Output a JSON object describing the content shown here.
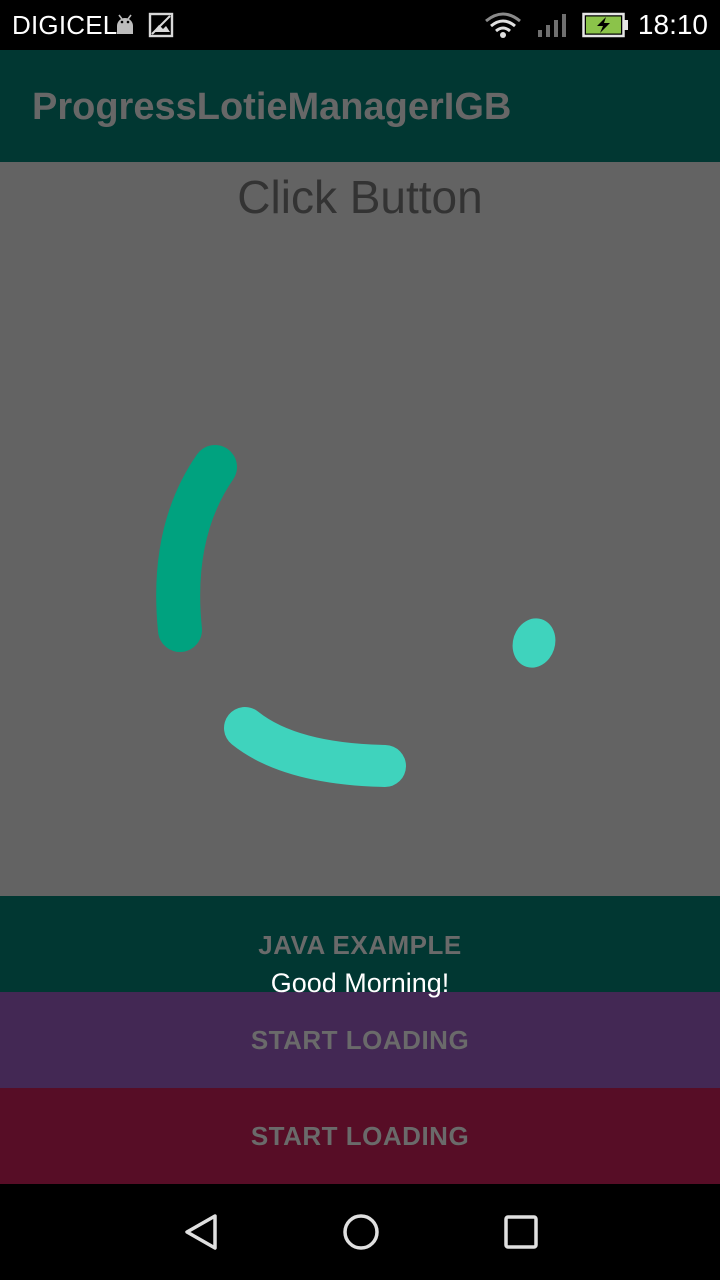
{
  "status_bar": {
    "carrier": "DIGICEL",
    "time": "18:10",
    "icons": [
      "android-icon",
      "image-icon",
      "wifi-icon",
      "signal-icon",
      "battery-charging-icon"
    ]
  },
  "app_bar": {
    "title": "ProgressLotieManagerIGB"
  },
  "content": {
    "title": "Click Button",
    "spinner_colors": {
      "dark_arc": "#00a27f",
      "light_arcs": "#3fd3bd"
    }
  },
  "buttons": {
    "java_example": "JAVA EXAMPLE",
    "start_loading_1": "START LOADING",
    "start_loading_2": "START LOADING"
  },
  "toast": {
    "text": "Good Morning!"
  },
  "nav_bar": {
    "icons": [
      "back-icon",
      "home-icon",
      "recents-icon"
    ]
  },
  "colors": {
    "app_bar_bg": "#013732",
    "overlay_bg": "#636363",
    "purple_button": "#432854",
    "maroon_button": "#570d26"
  }
}
